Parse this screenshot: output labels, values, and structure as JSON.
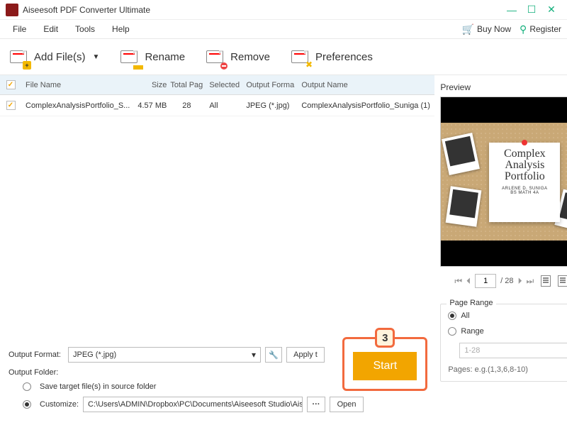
{
  "app": {
    "title": "Aiseesoft PDF Converter Ultimate"
  },
  "menu": {
    "file": "File",
    "edit": "Edit",
    "tools": "Tools",
    "help": "Help",
    "buy": "Buy Now",
    "register": "Register"
  },
  "toolbar": {
    "addfiles": "Add File(s)",
    "rename": "Rename",
    "remove": "Remove",
    "preferences": "Preferences"
  },
  "table": {
    "headers": {
      "filename": "File Name",
      "size": "Size",
      "pages": "Total Pag",
      "selected": "Selected",
      "format": "Output Forma",
      "output": "Output Name"
    },
    "rows": [
      {
        "filename": "ComplexAnalysisPortfolio_S...",
        "size": "4.57 MB",
        "pages": "28",
        "selected": "All",
        "format": "JPEG (*.jpg)",
        "output": "ComplexAnalysisPortfolio_Suniga (1)"
      }
    ]
  },
  "output": {
    "format_label": "Output Format:",
    "format_value": "JPEG (*.jpg)",
    "apply": "Apply t",
    "folder_label": "Output Folder:",
    "save_source": "Save target file(s) in source folder",
    "customize_label": "Customize:",
    "customize_path": "C:\\Users\\ADMIN\\Dropbox\\PC\\Documents\\Aiseesoft Studio\\Aiseesoft P",
    "open": "Open"
  },
  "start": {
    "badge": "3",
    "label": "Start"
  },
  "preview": {
    "title": "Preview",
    "doc_title_1": "Complex",
    "doc_title_2": "Analysis",
    "doc_title_3": "Portfolio",
    "author1": "ARLENE D. SUNIGA",
    "author2": "BS MATH 4A",
    "page": "1",
    "total": "/ 28"
  },
  "range": {
    "legend": "Page Range",
    "all": "All",
    "range": "Range",
    "placeholder": "1-28",
    "hint": "Pages: e.g.(1,3,6,8-10)"
  }
}
